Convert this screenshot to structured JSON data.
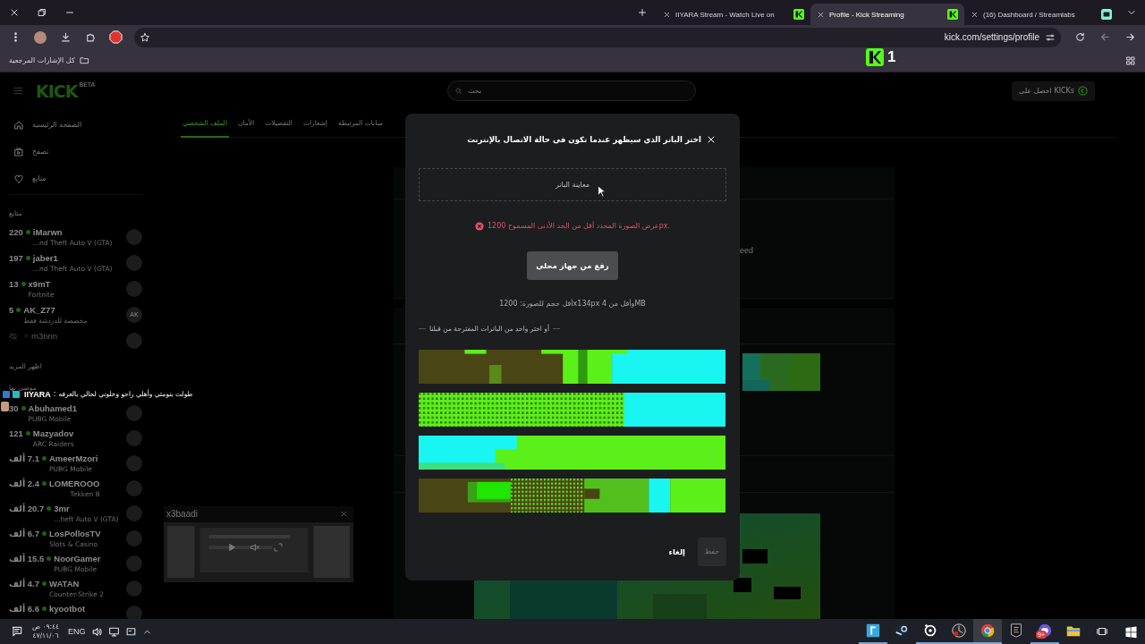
{
  "browser": {
    "tabs": [
      {
        "title": "(16) Dashboard / Streamlabs",
        "selected": false
      },
      {
        "title": "Profile - Kick Streaming",
        "selected": true
      },
      {
        "title": "IIYARA Stream - Watch Live on",
        "selected": false
      }
    ],
    "address": "kick.com/settings/profile",
    "bookmarks": [
      {
        "label": "كل الإشارات المرجعية"
      }
    ],
    "overlay_badge": "1"
  },
  "site": {
    "logo": "KICK",
    "logo_tag": "BETA",
    "search": {
      "placeholder": "بحث"
    },
    "get_kicks": "احصل على KICKs",
    "nav": [
      {
        "label": "الصفحة الرئيسية"
      },
      {
        "label": "تصفح"
      },
      {
        "label": "متابع"
      }
    ],
    "following_title": "متابع",
    "following": [
      {
        "viewers": "220",
        "name": "iMarwn",
        "game": "...nd Theft Auto V (GTA)",
        "live": true
      },
      {
        "viewers": "197",
        "name": "jaber1",
        "game": "...nd Theft Auto V (GTA)",
        "live": true
      },
      {
        "viewers": "13",
        "name": "x9mT",
        "game": "Fortnite",
        "live": true
      },
      {
        "viewers": "5",
        "name": "AK_Z77",
        "game": "مخصصة للدردشة فقط",
        "live": true,
        "avatar_text": "AK"
      },
      {
        "name": "m3nnn",
        "live": false
      }
    ],
    "show_more": "اظهر المزيد",
    "recommended_title": "موصى بها",
    "recommended": [
      {
        "viewers": "30",
        "name": "Abuhamed1",
        "game": "PUBG Mobile",
        "live": true
      },
      {
        "viewers": "121",
        "name": "Mazyadov",
        "game": "ARC Raiders",
        "live": true
      },
      {
        "viewers": "7.1 ألف",
        "name": "AmeerMzori",
        "game": "PUBG Mobile",
        "live": true
      },
      {
        "viewers": "2.4 ألف",
        "name": "LOMEROOO",
        "game": "Tekken 8",
        "live": true
      },
      {
        "viewers": "20.7 ألف",
        "name": "3mr",
        "game": "...heft Auto V (GTA)",
        "live": true
      },
      {
        "viewers": "6.7 ألف",
        "name": "LosPollosTV",
        "game": "Slots & Casino",
        "live": true
      },
      {
        "viewers": "15.5 ألف",
        "name": "NoorGamer",
        "game": "PUBG Mobile",
        "live": true
      },
      {
        "viewers": "4.7 ألف",
        "name": "WATAN",
        "game": "Counter-Strike 2",
        "live": true
      },
      {
        "viewers": "6.6 ألف",
        "name": "kyootbot",
        "live": true
      }
    ],
    "chat_message": {
      "user": "IIYARA",
      "separator": ":",
      "text": "طولت بنومتي وأهلي راحو وخلوني لحالي بالغرفه"
    },
    "settings_tabs": [
      {
        "label": "سابات المرتبطة",
        "selected": false
      },
      {
        "label": "إشعارات",
        "selected": false
      },
      {
        "label": "التفضيلات",
        "selected": false
      },
      {
        "label": "الأمان",
        "selected": false
      },
      {
        "label": "الملف الشخصي",
        "selected": true
      }
    ],
    "background_text": "eed",
    "mini_player": {
      "title": "x3baadi"
    }
  },
  "modal": {
    "title": "اختر البانر الذي سيظهر عندما تكون في حالة الاتصال بالإنترنت",
    "preview": "معاينة البانر",
    "error": "عرض الصورة المحدد أقل من الحد الأدنى المسموح 1200px.",
    "upload": "رفع من جهاز محلي",
    "requirements": "أقل حجم للصورة: 1200x134px وأقل من 4MB",
    "suggested_heading": "أو اختر واحد من البانرات المقترحة من قبلنا",
    "cancel": "إلغاء",
    "save": {
      "label": "حفظ",
      "disabled": true
    }
  },
  "taskbar": {
    "time": "٠٩:٤٤ ص",
    "date": "٤٧/١١/٠٦",
    "language": "ENG",
    "apps": [
      {
        "running": true,
        "active": false
      },
      {
        "running": false,
        "active": false
      },
      {
        "running": true,
        "active": false
      },
      {
        "running": true,
        "active": false
      },
      {
        "running": true,
        "active": true
      },
      {
        "running": false,
        "active": false
      },
      {
        "running": true,
        "active": false,
        "badge": "9+"
      },
      {
        "running": false,
        "active": false
      }
    ]
  }
}
